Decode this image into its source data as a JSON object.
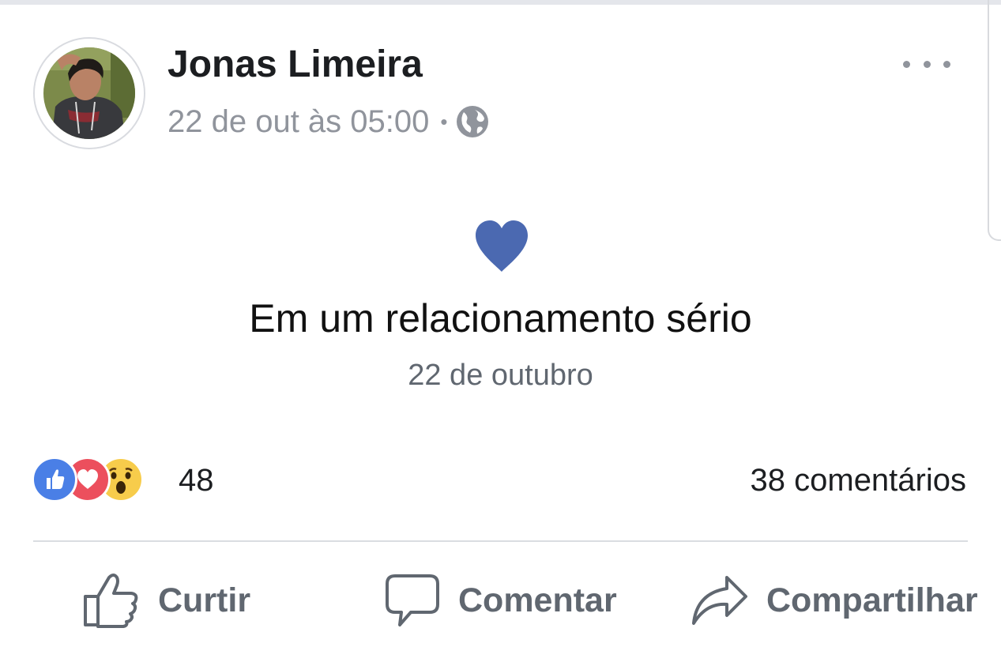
{
  "post": {
    "author": "Jonas Limeira",
    "timestamp": "22 de out às 05:00",
    "separator": "•",
    "privacy_icon": "globe-icon",
    "options_icon": "more-options-icon"
  },
  "life_event": {
    "icon": "heart-icon",
    "title": "Em um relacionamento sério",
    "date": "22 de outubro",
    "accent_color": "#4b69b1"
  },
  "engagement": {
    "reactions": [
      "like",
      "love",
      "wow"
    ],
    "reaction_count": "48",
    "comments": "38 comentários"
  },
  "actions": {
    "like_label": "Curtir",
    "comment_label": "Comentar",
    "share_label": "Compartilhar"
  },
  "colors": {
    "like_blue": "#4a7fe6",
    "love_red": "#ec4f5d",
    "wow_yellow": "#f7cc4b",
    "muted_text": "#606770"
  }
}
